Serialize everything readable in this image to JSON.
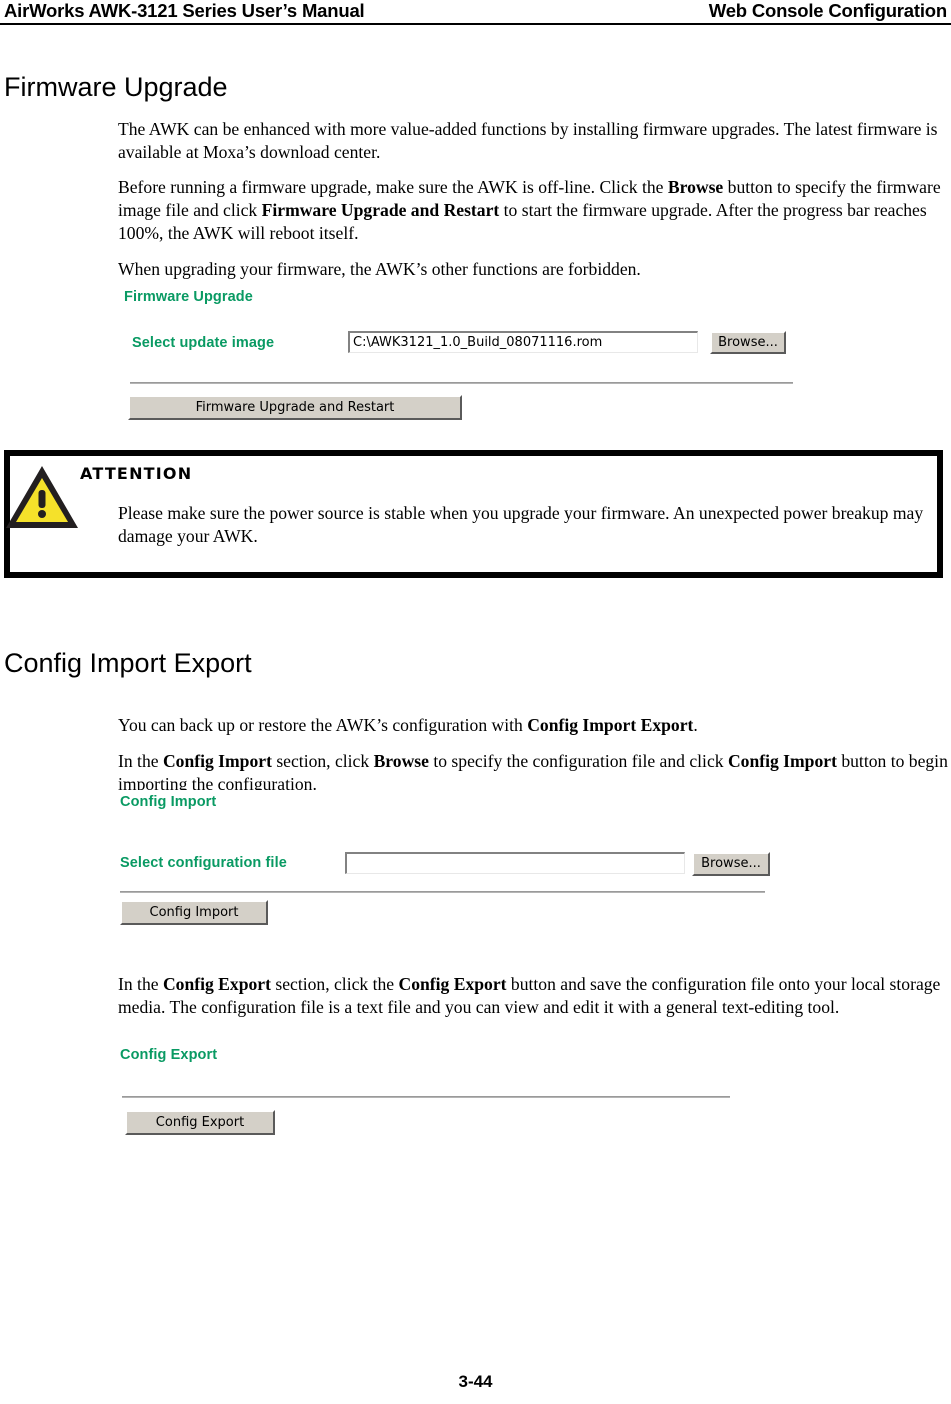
{
  "header": {
    "left_title": "AirWorks AWK-3121 Series User’s Manual",
    "right_title": "Web Console Configuration"
  },
  "footer": {
    "page_number": "3-44"
  },
  "colors": {
    "console_green": "#099a63",
    "button_face": "#d4d0c8",
    "warning_yellow": "#f5e12a",
    "warning_outline": "#231f20"
  },
  "sections": [
    {
      "heading": "Firmware Upgrade",
      "paragraphs": [
        "The AWK can be enhanced with more value-added functions by installing firmware upgrades. The latest firmware is available at Moxa’s download center.",
        "Before running a firmware upgrade, make sure the AWK is off-line. Click the Browse button to specify the firmware image file and click Firmware Upgrade and Restart to start the firmware upgrade. After the progress bar reaches 100%, the AWK will reboot itself.",
        "When upgrading your firmware, the AWK’s other functions are forbidden."
      ]
    },
    {
      "heading": "Config Import Export",
      "paragraphs": [
        "You can back up or restore the AWK’s configuration with Config Import Export.",
        "In the Config Import section, click Browse to specify the configuration file and click Config Import button to begin importing the configuration.",
        "In the Config Export section, click the Config Export button and save the configuration file onto your local storage media. The configuration file is a text file and you can view and edit it with a general text-editing tool."
      ]
    }
  ],
  "firmware_panel": {
    "title": "Firmware Upgrade",
    "field_label": "Select update image",
    "file_value": "C:\\AWK3121_1.0_Build_08071116.rom",
    "browse_label": "Browse...",
    "submit_label": "Firmware Upgrade and Restart"
  },
  "config_import_panel": {
    "title": "Config Import",
    "field_label": "Select configuration file",
    "file_value": "",
    "browse_label": "Browse...",
    "submit_label": "Config Import"
  },
  "config_export_panel": {
    "title": "Config Export",
    "submit_label": "Config Export"
  },
  "attention": {
    "title": "ATTENTION",
    "icon": "warning-triangle-icon",
    "body": "Please make sure the power source is stable when you upgrade your firmware. An unexpected power breakup may damage your AWK."
  }
}
